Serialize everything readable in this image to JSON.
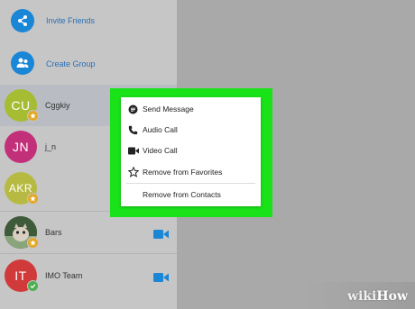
{
  "sidebar": {
    "actions": [
      {
        "label": "Invite Friends",
        "icon": "share-icon"
      },
      {
        "label": "Create Group",
        "icon": "group-icon"
      }
    ],
    "contacts": [
      {
        "initials": "CU",
        "name": "Cggkiy",
        "avatar_color": "#a6bc33",
        "badge": "star",
        "selected": true
      },
      {
        "initials": "JN",
        "name": "j_n",
        "avatar_color": "#c2307a",
        "badge": "none",
        "selected": false
      },
      {
        "initials": "AKR",
        "name": "",
        "avatar_color": "#b7ba42",
        "badge": "star",
        "selected": false
      },
      {
        "initials": "",
        "name": "Bars",
        "avatar_color": "#5a7a55",
        "badge": "star",
        "video": true,
        "selected": false
      },
      {
        "initials": "IT",
        "name": "IMO Team",
        "avatar_color": "#d13a3a",
        "badge": "check",
        "video": true,
        "selected": false
      }
    ]
  },
  "context_menu": {
    "items": [
      {
        "label": "Send Message",
        "icon": "chat-icon"
      },
      {
        "label": "Audio Call",
        "icon": "phone-icon"
      },
      {
        "label": "Video Call",
        "icon": "video-icon"
      },
      {
        "label": "Remove from Favorites",
        "icon": "star-outline-icon"
      },
      {
        "label": "Remove from Contacts",
        "icon": ""
      }
    ]
  },
  "watermark": {
    "part1": "wiki",
    "part2": "How"
  },
  "colors": {
    "accent": "#1a86d6",
    "highlight": "#19e219",
    "sidebar_bg": "#c6c6c6",
    "main_bg": "#a9a9a9"
  }
}
